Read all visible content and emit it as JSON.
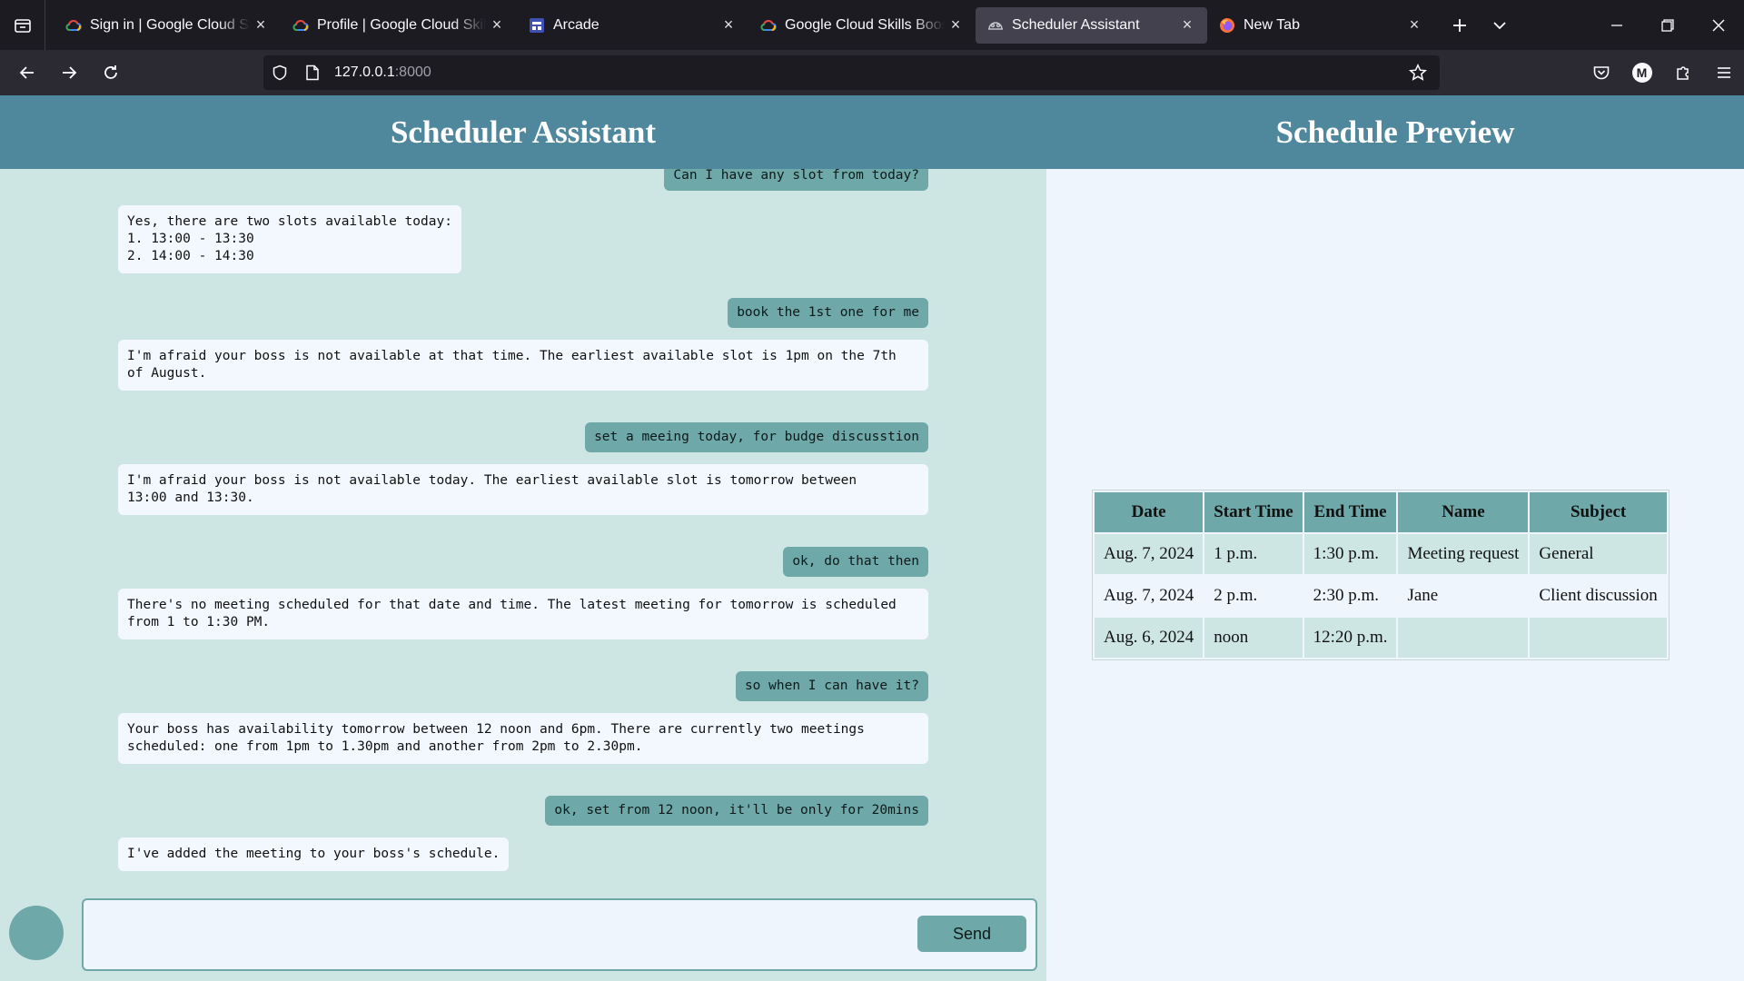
{
  "browser": {
    "tabs": [
      {
        "title": "Sign in | Google Cloud Skills Boost",
        "icon": "google-cloud-icon",
        "active": false
      },
      {
        "title": "Profile | Google Cloud Skills Boost",
        "icon": "google-cloud-icon",
        "active": false
      },
      {
        "title": "Arcade",
        "icon": "arcade-icon",
        "active": false
      },
      {
        "title": "Google Cloud Skills Boost",
        "icon": "google-cloud-icon",
        "active": false
      },
      {
        "title": "Scheduler Assistant",
        "icon": "generic-page-icon",
        "active": true
      },
      {
        "title": "New Tab",
        "icon": "firefox-icon",
        "active": false
      }
    ],
    "url_host": "127.0.0.1",
    "url_port": ":8000",
    "profile_initial": "M"
  },
  "chat_panel": {
    "title": "Scheduler Assistant",
    "messages": [
      {
        "role": "user",
        "text": "Can I have any slot from today?"
      },
      {
        "role": "bot",
        "text": "Yes, there are two slots available today:\n1. 13:00 - 13:30\n2. 14:00 - 14:30"
      },
      {
        "role": "user",
        "text": "book the 1st one for me"
      },
      {
        "role": "bot",
        "text": "I'm afraid your boss is not available at that time. The earliest available slot is 1pm on the 7th\nof August."
      },
      {
        "role": "user",
        "text": "set a meeing today, for budge discusstion"
      },
      {
        "role": "bot",
        "text": "I'm afraid your boss is not available today. The earliest available slot is tomorrow between\n13:00 and 13:30."
      },
      {
        "role": "user",
        "text": "ok, do that then"
      },
      {
        "role": "bot",
        "text": "There's no meeting scheduled for that date and time. The latest meeting for tomorrow is scheduled\nfrom 1 to 1:30 PM."
      },
      {
        "role": "user",
        "text": "so when I can have it?"
      },
      {
        "role": "bot",
        "text": "Your boss has availability tomorrow between 12 noon and 6pm. There are currently two meetings\nscheduled: one from 1pm to 1.30pm and another from 2pm to 2.30pm."
      },
      {
        "role": "user",
        "text": "ok, set from 12 noon, it'll be only for 20mins"
      },
      {
        "role": "bot",
        "text": "I've added the meeting to your boss's schedule."
      }
    ],
    "input": {
      "value": "",
      "placeholder": ""
    },
    "send_label": "Send"
  },
  "preview_panel": {
    "title": "Schedule Preview",
    "columns": [
      "Date",
      "Start Time",
      "End Time",
      "Name",
      "Subject"
    ],
    "rows": [
      [
        "Aug. 7, 2024",
        "1 p.m.",
        "1:30 p.m.",
        "Meeting request",
        "General"
      ],
      [
        "Aug. 7, 2024",
        "2 p.m.",
        "2:30 p.m.",
        "Jane",
        "Client discussion"
      ],
      [
        "Aug. 6, 2024",
        "noon",
        "12:20 p.m.",
        "",
        ""
      ]
    ]
  },
  "colors": {
    "header": "#4f889d",
    "accent": "#6fa8a8",
    "chat_bg": "#cde6e3",
    "page_bg": "#eef5fd"
  }
}
